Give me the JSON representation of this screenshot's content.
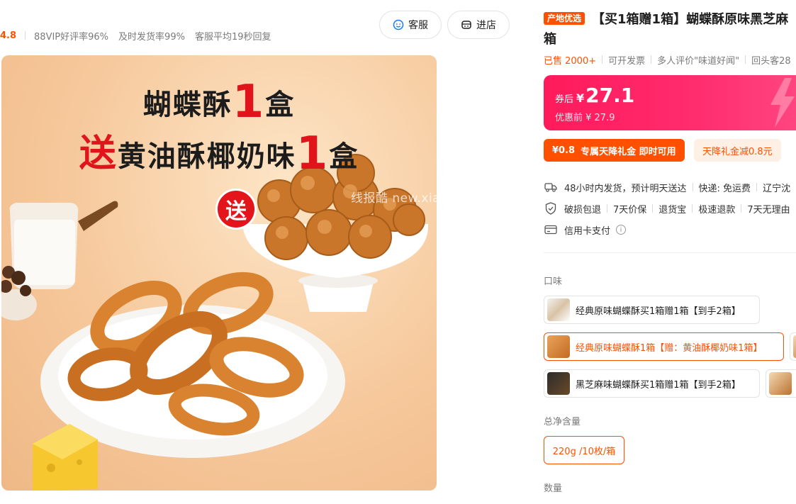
{
  "shop": {
    "score": "4.8",
    "stats": [
      "88VIP好评率96%",
      "及时发货率99%",
      "客服平均19秒回复"
    ],
    "service_button": "客服",
    "store_button": "进店"
  },
  "image": {
    "line1_a": "蝴蝶酥",
    "line1_num": "1",
    "line1_b": "盒",
    "line2_a": "送",
    "line2_b": "黄油酥椰奶味",
    "line2_num": "1",
    "line2_c": "盒",
    "gift_badge": "送",
    "watermark": "线报酷 new.xianbao.fun"
  },
  "product": {
    "origin_tag": "产地优选",
    "title_line1": "【买1箱赠1箱】蝴蝶酥原味黑芝麻",
    "title_line2": "箱",
    "sold": "已售 2000+",
    "meta": [
      "可开发票",
      "多人评价\"味道好闻\"",
      "回头客28"
    ]
  },
  "price": {
    "after_label": "券后",
    "currency": "¥",
    "after_value": "27.1",
    "before": "优惠前 ¥ 27.9"
  },
  "coupon": {
    "amount": "¥0.8",
    "text": "专属天降礼金 即时可用",
    "note": "天降礼金减0.8元"
  },
  "services": {
    "shipping": [
      "48小时内发货，预计明天送达",
      "快递: 免运费",
      "辽宁沈"
    ],
    "guarantees": [
      "破损包退",
      "7天价保",
      "退货宝",
      "极速退款",
      "7天无理由"
    ],
    "payment": "信用卡支付",
    "info_glyph": "i"
  },
  "options": {
    "flavor_label": "口味",
    "flavors": [
      "经典原味蝴蝶酥买1箱赠1箱【到手2箱】",
      "经典原味蝴蝶酥1箱【赠：黄油酥椰奶味1箱】",
      "黑芝麻味蝴蝶酥买1箱赠1箱【到手2箱】"
    ],
    "weight_label": "总净含量",
    "weight": "220g /10枚/箱",
    "quantity_label": "数量"
  },
  "colors": {
    "accent": "#ff5000",
    "price_bg": "#ff2c6e",
    "sold": "#ff5000"
  }
}
